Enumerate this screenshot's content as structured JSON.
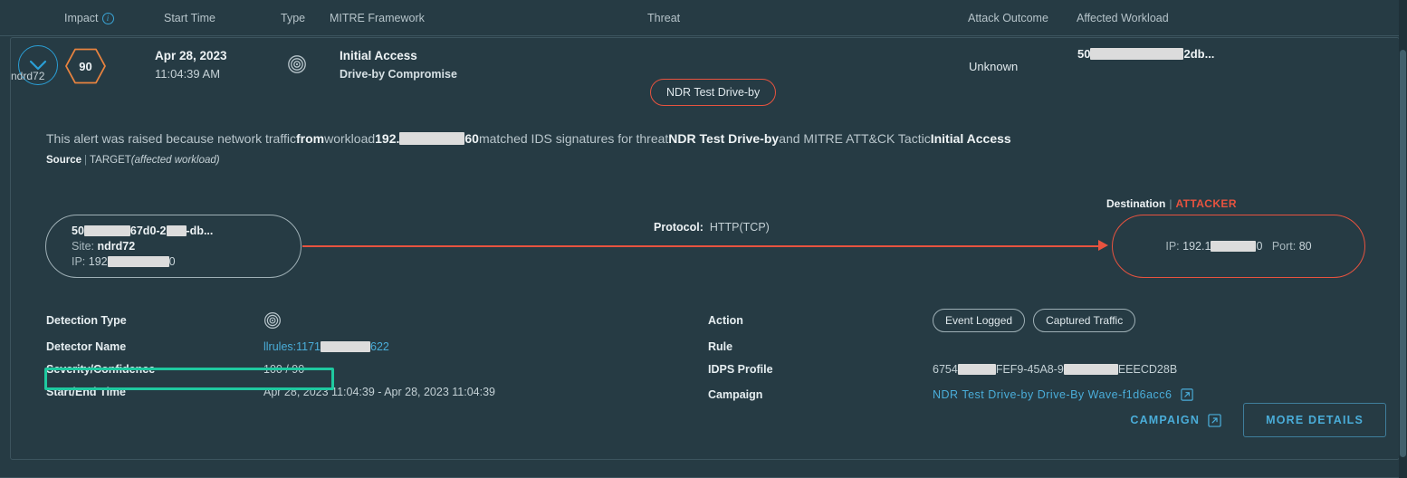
{
  "columns": {
    "impact": "Impact",
    "start_time": "Start Time",
    "type": "Type",
    "mitre": "MITRE Framework",
    "threat": "Threat",
    "attack_outcome": "Attack Outcome",
    "affected_workload": "Affected Workload"
  },
  "summary": {
    "impact_score": "90",
    "date": "Apr 28, 2023",
    "time": "11:04:39 AM",
    "tactic": "Initial Access",
    "technique": "Drive-by Compromise",
    "threat": "NDR Test Drive-by",
    "attack_outcome": "Unknown",
    "workload_prefix": "50",
    "workload_suffix": "2db...",
    "workload_site": "ndrd72"
  },
  "description": {
    "part1": "This alert was raised because network traffic ",
    "bold_from": "from",
    "part2": " workload ",
    "ip_prefix": "192.",
    "ip_suffix": "60",
    "part3": " matched IDS signatures for threat ",
    "bold_threat": "NDR Test Drive-by",
    "part4": " and MITRE ATT&CK Tactic ",
    "bold_tactic": "Initial Access"
  },
  "source_tag": {
    "source": "Source",
    "separator": "|",
    "target": "TARGET",
    "note": "(affected workload)"
  },
  "flow": {
    "source_node": {
      "name_prefix": "50",
      "name_mid": "67d0-2",
      "name_suffix": "-db...",
      "site_label": "Site:",
      "site_value": "ndrd72",
      "ip_label": "IP:",
      "ip_prefix": "192",
      "ip_suffix": "0"
    },
    "protocol_label": "Protocol:",
    "protocol_value": "HTTP(TCP)",
    "destination_label": "Destination",
    "destination_separator": "|",
    "destination_role": "ATTACKER",
    "dest_node": {
      "ip_label": "IP:",
      "ip_prefix": "192.1",
      "ip_suffix": "0",
      "port_label": "Port:",
      "port_value": "80"
    }
  },
  "details_left": [
    {
      "key": "Detection Type",
      "value": "",
      "icon": "target-icon"
    },
    {
      "key": "Detector Name",
      "value_prefix": "llrules:1171",
      "value_suffix": "622",
      "link": true
    },
    {
      "key": "Severity/Confidence",
      "value": "100 / 90",
      "highlighted": true
    },
    {
      "key": "Start/End Time",
      "value": "Apr 28, 2023 11:04:39 - Apr 28, 2023 11:04:39"
    }
  ],
  "details_right": {
    "action_label": "Action",
    "action_tags": [
      "Event Logged",
      "Captured Traffic"
    ],
    "rule_label": "Rule",
    "rule_value": "",
    "idps_label": "IDPS Profile",
    "idps_prefix": "6754",
    "idps_mid": "FEF9-45A8-9",
    "idps_suffix": "EEECD28B",
    "campaign_label": "Campaign",
    "campaign_value": "NDR Test Drive-by Drive-By Wave-f1d6acc6"
  },
  "footer": {
    "campaign_button": "CAMPAIGN",
    "more_details_button": "MORE DETAILS"
  },
  "colors": {
    "background": "#263b44",
    "accent_blue": "#4aadd9",
    "attacker_red": "#e8533f",
    "impact_orange": "#e8833f",
    "highlight_teal": "#1fc9a0"
  }
}
